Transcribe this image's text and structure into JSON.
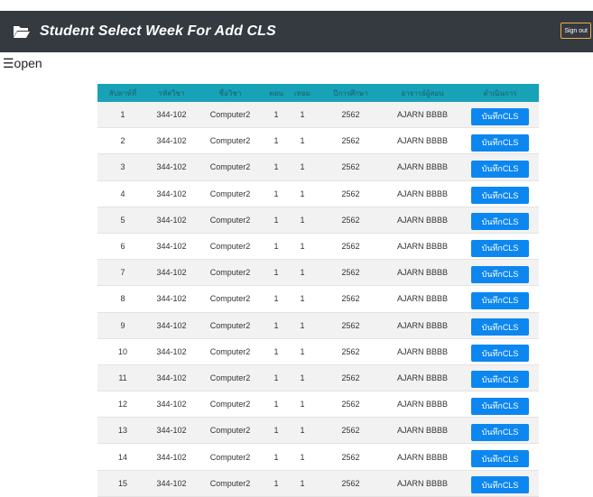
{
  "header": {
    "title": "Student Select Week For Add CLS",
    "signout_label": "Sign out",
    "icon": "folder-open-icon"
  },
  "sidebar_toggle": {
    "label": "☰open"
  },
  "table": {
    "columns": [
      "สัปดาห์ที่",
      "รหัสวิชา",
      "ชื่อวิชา",
      "ตอน",
      "เทอม",
      "ปีการศึกษา",
      "อาจารย์ผู้สอน",
      "ดำเนินการ"
    ],
    "action_label": "บันทึกCLS",
    "rows": [
      {
        "week": "1",
        "code": "344-102",
        "name": "Computer2",
        "section": "1",
        "term": "1",
        "year": "2562",
        "teacher": "AJARN BBBB"
      },
      {
        "week": "2",
        "code": "344-102",
        "name": "Computer2",
        "section": "1",
        "term": "1",
        "year": "2562",
        "teacher": "AJARN BBBB"
      },
      {
        "week": "3",
        "code": "344-102",
        "name": "Computer2",
        "section": "1",
        "term": "1",
        "year": "2562",
        "teacher": "AJARN BBBB"
      },
      {
        "week": "4",
        "code": "344-102",
        "name": "Computer2",
        "section": "1",
        "term": "1",
        "year": "2562",
        "teacher": "AJARN BBBB"
      },
      {
        "week": "5",
        "code": "344-102",
        "name": "Computer2",
        "section": "1",
        "term": "1",
        "year": "2562",
        "teacher": "AJARN BBBB"
      },
      {
        "week": "6",
        "code": "344-102",
        "name": "Computer2",
        "section": "1",
        "term": "1",
        "year": "2562",
        "teacher": "AJARN BBBB"
      },
      {
        "week": "7",
        "code": "344-102",
        "name": "Computer2",
        "section": "1",
        "term": "1",
        "year": "2562",
        "teacher": "AJARN BBBB"
      },
      {
        "week": "8",
        "code": "344-102",
        "name": "Computer2",
        "section": "1",
        "term": "1",
        "year": "2562",
        "teacher": "AJARN BBBB"
      },
      {
        "week": "9",
        "code": "344-102",
        "name": "Computer2",
        "section": "1",
        "term": "1",
        "year": "2562",
        "teacher": "AJARN BBBB"
      },
      {
        "week": "10",
        "code": "344-102",
        "name": "Computer2",
        "section": "1",
        "term": "1",
        "year": "2562",
        "teacher": "AJARN BBBB"
      },
      {
        "week": "11",
        "code": "344-102",
        "name": "Computer2",
        "section": "1",
        "term": "1",
        "year": "2562",
        "teacher": "AJARN BBBB"
      },
      {
        "week": "12",
        "code": "344-102",
        "name": "Computer2",
        "section": "1",
        "term": "1",
        "year": "2562",
        "teacher": "AJARN BBBB"
      },
      {
        "week": "13",
        "code": "344-102",
        "name": "Computer2",
        "section": "1",
        "term": "1",
        "year": "2562",
        "teacher": "AJARN BBBB"
      },
      {
        "week": "14",
        "code": "344-102",
        "name": "Computer2",
        "section": "1",
        "term": "1",
        "year": "2562",
        "teacher": "AJARN BBBB"
      },
      {
        "week": "15",
        "code": "344-102",
        "name": "Computer2",
        "section": "1",
        "term": "1",
        "year": "2562",
        "teacher": "AJARN BBBB"
      }
    ]
  },
  "colors": {
    "header_bg": "#343a40",
    "table_header_bg": "#17a2b8",
    "button_bg": "#0d87f0",
    "signout_border": "#f0ad4e"
  }
}
